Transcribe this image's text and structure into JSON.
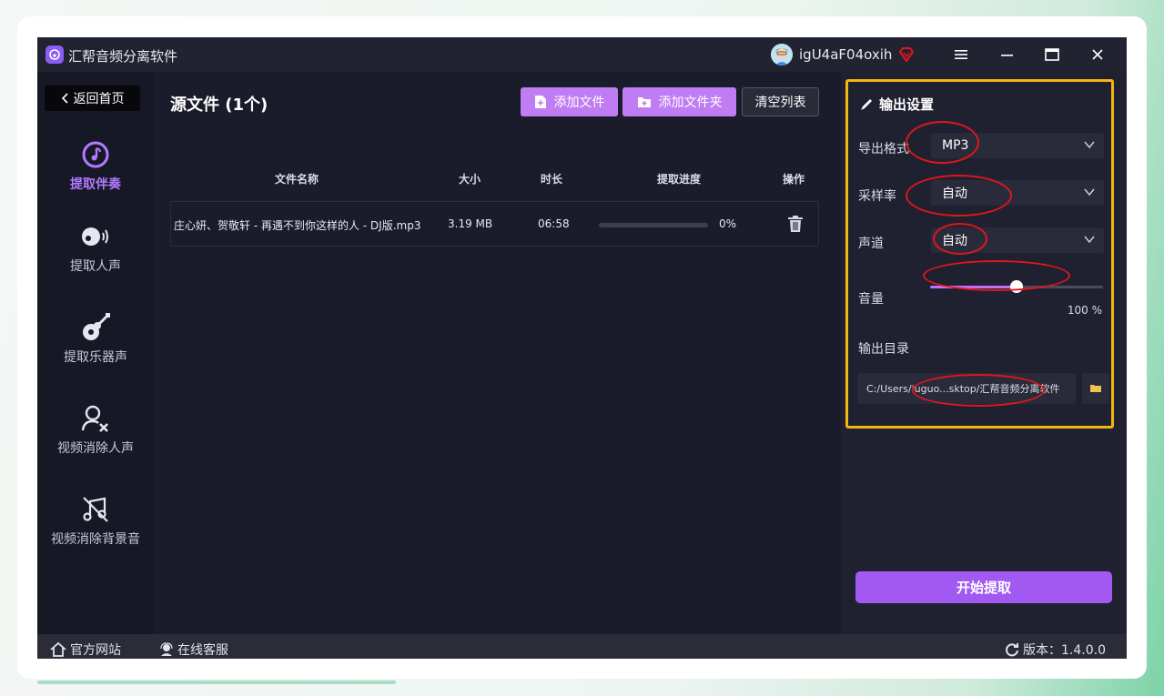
{
  "window": {
    "title": "汇帮音频分离软件",
    "username": "igU4aF04oxih"
  },
  "sidebar": {
    "back_label": "返回首页",
    "items": [
      {
        "label": "提取伴奏",
        "icon": "music-note-icon",
        "active": true
      },
      {
        "label": "提取人声",
        "icon": "voice-icon",
        "active": false
      },
      {
        "label": "提取乐器声",
        "icon": "guitar-icon",
        "active": false
      },
      {
        "label": "视频消除人声",
        "icon": "user-remove-icon",
        "active": false
      },
      {
        "label": "视频消除背景音",
        "icon": "music-off-icon",
        "active": false
      }
    ]
  },
  "main": {
    "title": "源文件 (1个)",
    "add_file_label": "添加文件",
    "add_folder_label": "添加文件夹",
    "clear_label": "清空列表",
    "columns": [
      "文件名称",
      "大小",
      "时长",
      "提取进度",
      "操作"
    ],
    "rows": [
      {
        "name": "庄心妍、贺敬轩 - 再遇不到你这样的人 - DJ版.mp3",
        "size": "3.19 MB",
        "duration": "06:58",
        "progress": "0%",
        "progress_value": 0
      }
    ]
  },
  "settings": {
    "title": "输出设置",
    "format_label": "导出格式",
    "format_value": "MP3",
    "samplerate_label": "采样率",
    "samplerate_value": "自动",
    "channel_label": "声道",
    "channel_value": "自动",
    "volume_label": "音量",
    "volume_value": 0.5,
    "volume_pct": "100 %",
    "outdir_label": "输出目录",
    "outdir_value": "C:/Users/iuguo...sktop/汇帮音频分离软件",
    "start_label": "开始提取"
  },
  "footer": {
    "website_label": "官方网站",
    "support_label": "在线客服",
    "version_label": "版本：1.4.0.0"
  },
  "colors": {
    "accent": "#a259f2",
    "annotation_box": "#f5b50f",
    "annotation_circle": "#e0161b"
  }
}
